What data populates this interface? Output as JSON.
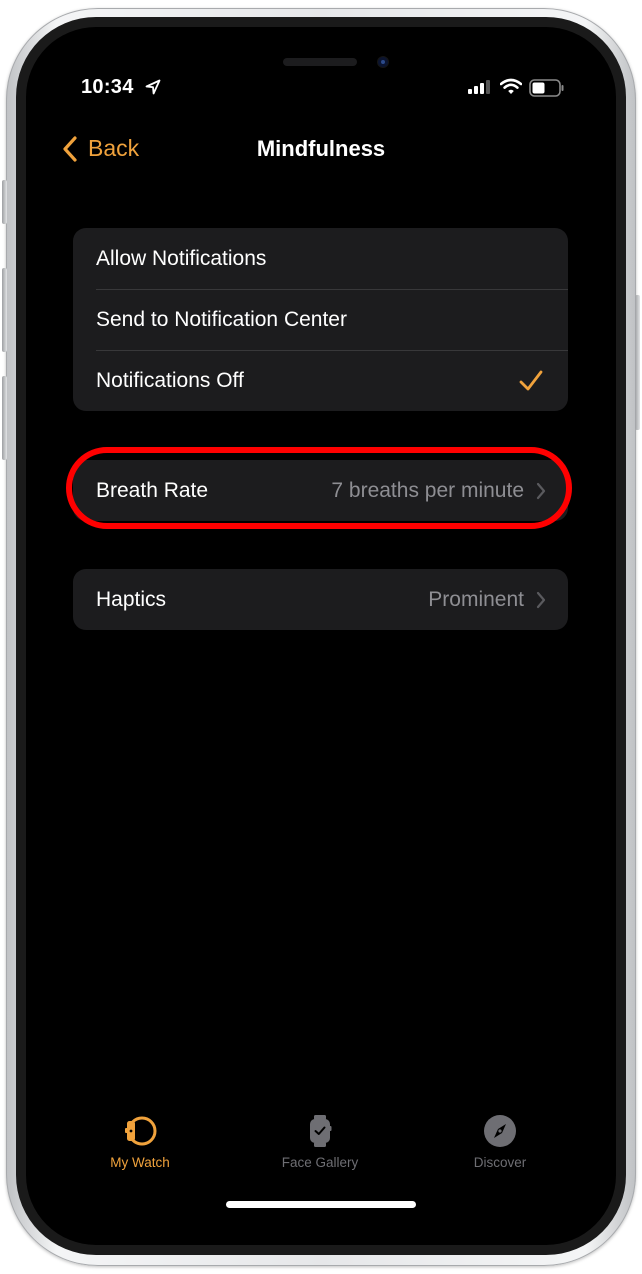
{
  "status_bar": {
    "time": "10:34",
    "location_icon": "location-arrow-icon",
    "signal_icon": "cellular-signal-icon",
    "wifi_icon": "wifi-icon",
    "battery_icon": "battery-icon"
  },
  "nav": {
    "back_label": "Back",
    "title": "Mindfulness"
  },
  "notifications_group": {
    "options": [
      {
        "label": "Allow Notifications",
        "selected": false
      },
      {
        "label": "Send to Notification Center",
        "selected": false
      },
      {
        "label": "Notifications Off",
        "selected": true
      }
    ]
  },
  "settings": {
    "breath_rate": {
      "label": "Breath Rate",
      "value": "7 breaths per minute",
      "highlighted": true
    },
    "haptics": {
      "label": "Haptics",
      "value": "Prominent"
    }
  },
  "tab_bar": {
    "tabs": [
      {
        "label": "My Watch",
        "icon": "my-watch-icon",
        "active": true
      },
      {
        "label": "Face Gallery",
        "icon": "face-gallery-icon",
        "active": false
      },
      {
        "label": "Discover",
        "icon": "discover-compass-icon",
        "active": false
      }
    ]
  },
  "colors": {
    "accent": "#f0a23c",
    "highlight_ring": "#ff0000",
    "secondary_text": "#8e8e93",
    "cell_background": "#1c1c1e",
    "inactive_tab": "#6e6e73"
  }
}
